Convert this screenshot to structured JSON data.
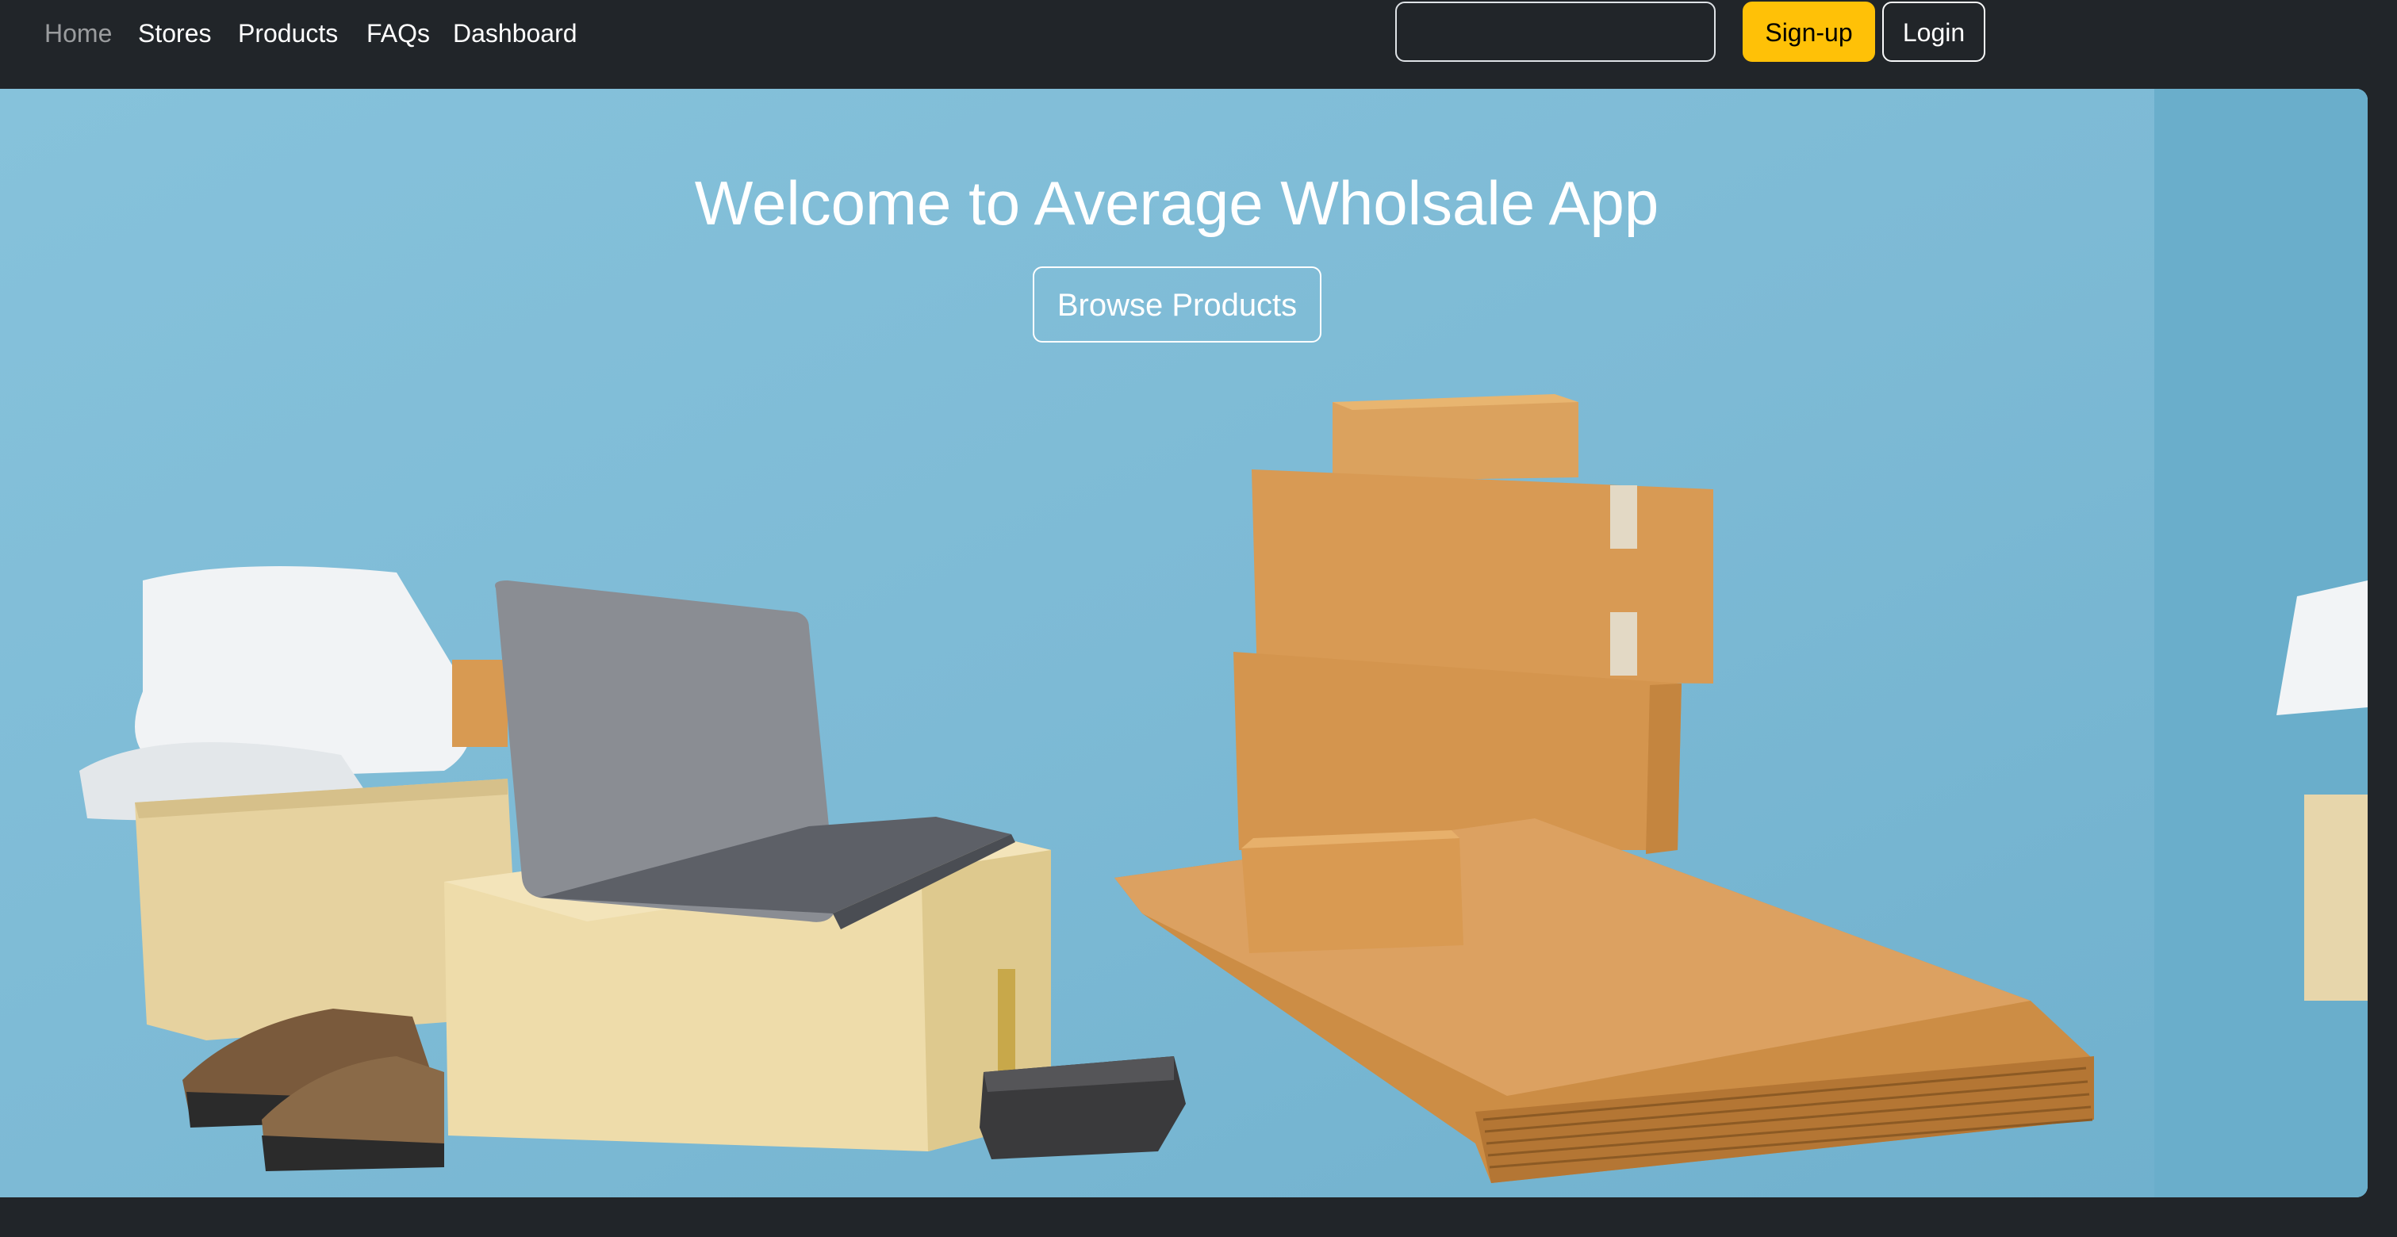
{
  "nav": {
    "links": [
      {
        "label": "Home",
        "active": true
      },
      {
        "label": "Stores"
      },
      {
        "label": "Products"
      },
      {
        "label": "FAQs"
      },
      {
        "label": "Dashboard"
      }
    ],
    "search": {
      "value": "",
      "placeholder": ""
    },
    "signup_label": "Sign-up",
    "login_label": "Login"
  },
  "hero": {
    "title": "Welcome to Average Wholsale App",
    "browse_label": "Browse Products",
    "image": "photo of cardboard boxes, laptop, calculator, shoes and poly mailer bags on light blue background"
  },
  "colors": {
    "navbar_bg": "#212529",
    "accent_warning": "#ffc107",
    "hero_bg": "#7fbcd6"
  }
}
